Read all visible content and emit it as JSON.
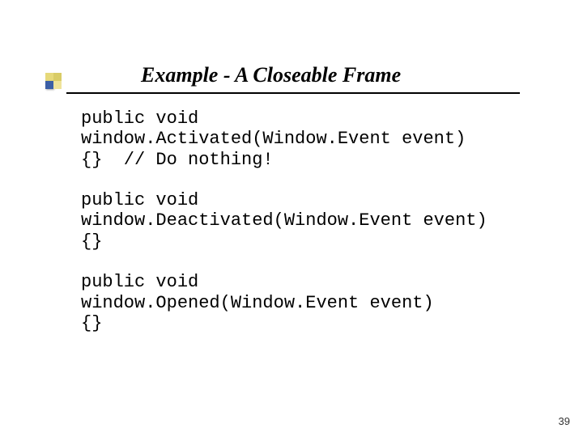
{
  "slide": {
    "title": "Example - A Closeable Frame",
    "page_number": "39"
  },
  "code": {
    "block1": "public void\nwindow.Activated(Window.Event event)\n{}  // Do nothing!",
    "block2": "public void\nwindow.Deactivated(Window.Event event)\n{}",
    "block3": "public void\nwindow.Opened(Window.Event event)\n{}"
  }
}
